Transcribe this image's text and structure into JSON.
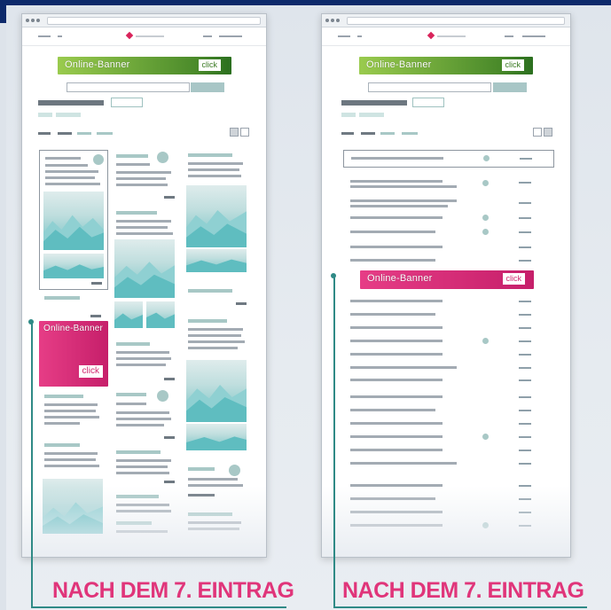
{
  "colors": {
    "accent_pink": "#e0357a",
    "banner_green": "#4a8a2a",
    "teal_line": "#2f8a86",
    "header_navy": "#0d2a6b"
  },
  "left_mockup": {
    "top_banner": {
      "label": "Online-Banner",
      "button": "click"
    },
    "inline_banner": {
      "label": "Online-Banner",
      "button": "click"
    },
    "caption": "NACH DEM 7. EINTRAG"
  },
  "right_mockup": {
    "top_banner": {
      "label": "Online-Banner",
      "button": "click"
    },
    "inline_banner": {
      "label": "Online-Banner",
      "button": "click"
    },
    "caption": "NACH DEM 7. EINTRAG"
  }
}
